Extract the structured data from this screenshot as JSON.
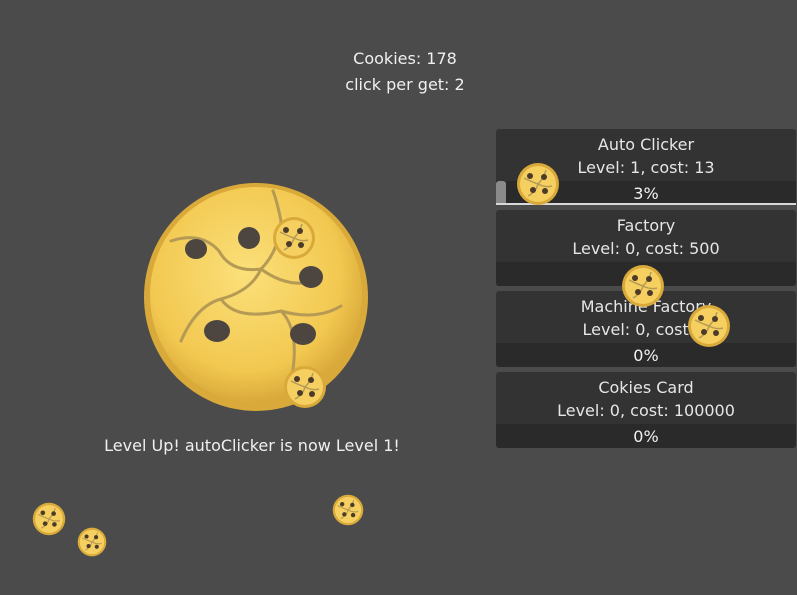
{
  "hud": {
    "cookies": "Cookies: 178",
    "click_per_get": "click per get: 2",
    "level_up_message": "Level Up! autoClicker is now Level 1!"
  },
  "shop": [
    {
      "name": "Auto Clicker",
      "info": "Level: 1, cost: 13",
      "progress_text": "3%",
      "progress": 0.03
    },
    {
      "name": "Factory",
      "info": "Level: 0, cost: 500",
      "progress_text": "",
      "progress": 0
    },
    {
      "name": "Machine Factory",
      "info": "Level: 0, cost: 1",
      "progress_text": "0%",
      "progress": 0
    },
    {
      "name": "Cokies Card",
      "info": "Level: 0, cost: 100000",
      "progress_text": "0%",
      "progress": 0
    }
  ],
  "colors": {
    "background": "#4b4b4b",
    "panel": "#333333",
    "cookie_fill": "#f5d060",
    "cookie_edge": "#d9a93a",
    "chip": "#4d3b2a"
  }
}
